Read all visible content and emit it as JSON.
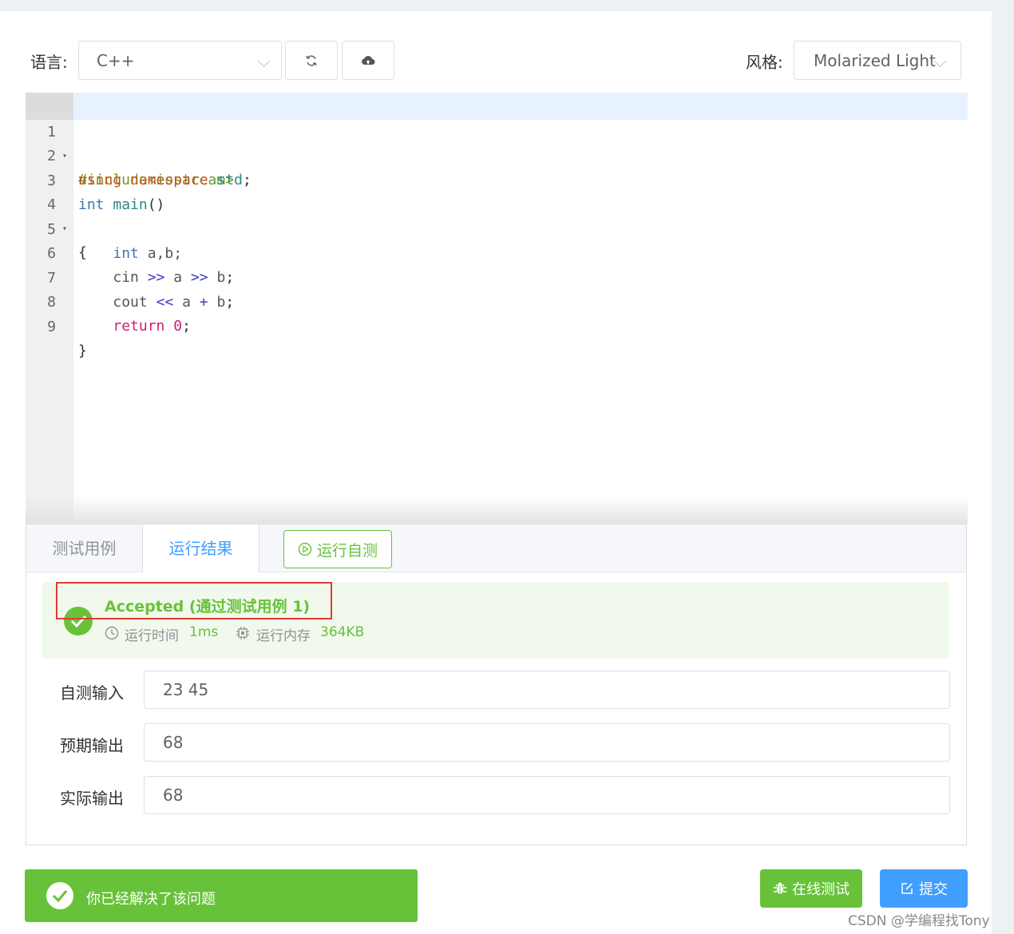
{
  "toolbar": {
    "language_label": "语言:",
    "language_value": "C++",
    "style_label": "风格:",
    "style_value": "Molarized Light",
    "reset_icon": "refresh-icon",
    "upload_icon": "cloud-upload-icon"
  },
  "editor": {
    "lines": [
      {
        "num": "1",
        "fold": "▾"
      },
      {
        "num": "2",
        "fold": ""
      },
      {
        "num": "3",
        "fold": ""
      },
      {
        "num": "4",
        "fold": "▾"
      },
      {
        "num": "5",
        "fold": ""
      },
      {
        "num": "6",
        "fold": ""
      },
      {
        "num": "7",
        "fold": ""
      },
      {
        "num": "8",
        "fold": ""
      },
      {
        "num": "9",
        "fold": ""
      }
    ],
    "code": {
      "l1": "#include<iostream>",
      "l2_kw": "using",
      "l2_kw2": "namespace",
      "l2_ns": "std",
      "l2_end": ";",
      "l3_type": "int",
      "l3_fn": "main",
      "l3_end": "()",
      "l4": "{",
      "l5_type": "int",
      "l5_rest": "a,b;",
      "l6_a": "cin",
      "l6_op1": ">>",
      "l6_b": "a",
      "l6_op2": ">>",
      "l6_c": "b",
      "l6_end": ";",
      "l7_a": "cout",
      "l7_op1": "<<",
      "l7_b": "a",
      "l7_op2": "+",
      "l7_c": "b",
      "l7_end": ";",
      "l8_kw": "return",
      "l8_num": "0",
      "l8_end": ";",
      "l9": "}"
    }
  },
  "panel": {
    "tabs": [
      {
        "label": "测试用例"
      },
      {
        "label": "运行结果"
      }
    ],
    "run_button": "运行自测",
    "result": {
      "status": "Accepted (通过测试用例 1)",
      "time_label": "运行时间",
      "time_value": "1ms",
      "memory_label": "运行内存",
      "memory_value": "364KB"
    },
    "rows": [
      {
        "label": "自测输入",
        "value": "23 45"
      },
      {
        "label": "预期输出",
        "value": "68"
      },
      {
        "label": "实际输出",
        "value": "68"
      }
    ]
  },
  "footer": {
    "solved_text": "你已经解决了该问题",
    "online_test": "在线测试",
    "submit": "提交"
  },
  "watermark": "CSDN @学编程找Tony",
  "colors": {
    "accent": "#409eff",
    "success": "#67c23a",
    "highlight_box": "#e53935"
  }
}
